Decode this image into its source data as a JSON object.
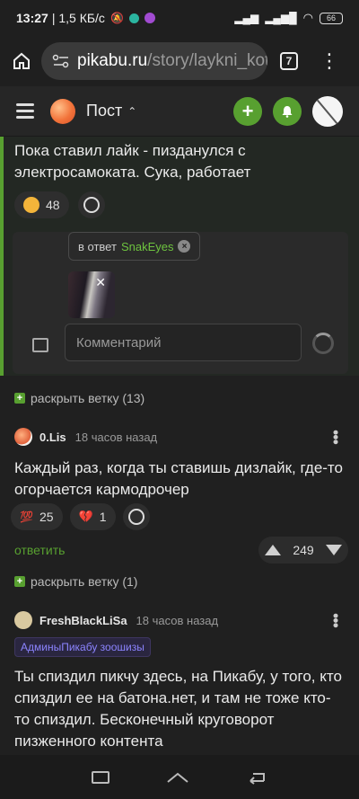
{
  "status": {
    "time": "13:27",
    "speed": "| 1,5 КБ/с",
    "battery": "66"
  },
  "browser": {
    "url_domain": "pikabu.ru",
    "url_path": "/story/laykni_kot",
    "tabs_count": "7"
  },
  "header": {
    "title": "Пост"
  },
  "thread": {
    "comment_text": "Пока ставил лайк - пизданулся с электросамоката. Сука, работает",
    "reaction_count": "48",
    "reply_to_label": "в ответ",
    "reply_to_nick": "SnakEyes",
    "comment_placeholder": "Комментарий",
    "expand_label": "раскрыть ветку (13)"
  },
  "comments": [
    {
      "nick": "0.Lis",
      "time": "18 часов назад",
      "text": "Каждый раз, когда ты ставишь дизлайк, где-то огорчается кармодрочер",
      "reaction_1": "25",
      "reaction_2": "1",
      "reply_label": "ответить",
      "rating": "249",
      "expand_label": "раскрыть ветку (1)"
    },
    {
      "nick": "FreshBlackLiSa",
      "time": "18 часов назад",
      "badge": "АдминыПикабу зоошизы",
      "text": "Ты спиздил пикчу здесь, на Пикабу, у того, кто спиздил ее на батона.нет, и там не тоже кто-то спиздил. Бесконечный круговорот пизженного контента"
    }
  ],
  "colors": {
    "accent": "#58a030",
    "background": "#202020",
    "badge": "#8c84ff"
  }
}
